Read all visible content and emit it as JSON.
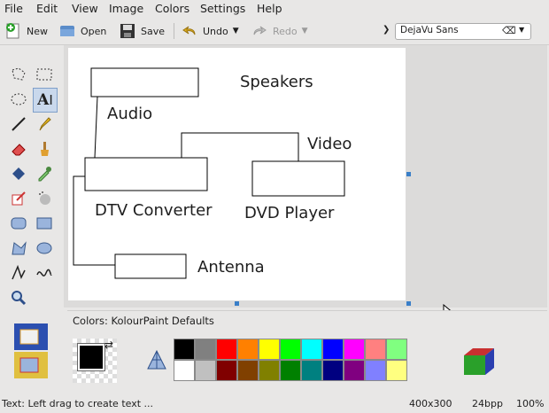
{
  "menu": [
    "File",
    "Edit",
    "View",
    "Image",
    "Colors",
    "Settings",
    "Help"
  ],
  "toolbar": {
    "new_label": "New",
    "open_label": "Open",
    "save_label": "Save",
    "undo_label": "Undo",
    "redo_label": "Redo",
    "font_value": "DejaVu Sans"
  },
  "diagram": {
    "speakers": "Speakers",
    "audio": "Audio",
    "video": "Video",
    "dtv": "DTV Converter",
    "dvd": "DVD Player",
    "antenna": "Antenna"
  },
  "colors_panel": {
    "title": "Colors: KolourPaint Defaults"
  },
  "palette_row1": [
    "#000000",
    "#808080",
    "#ff0000",
    "#ff8000",
    "#ffff00",
    "#00ff00",
    "#00ffff",
    "#0000ff",
    "#ff00ff",
    "#ff8080",
    "#80ff80"
  ],
  "palette_row2": [
    "#ffffff",
    "#c0c0c0",
    "#800000",
    "#804000",
    "#808000",
    "#008000",
    "#008080",
    "#000080",
    "#800080",
    "#8080ff",
    "#ffff80"
  ],
  "status": {
    "hint": "Text: Left drag to create text ...",
    "size": "400x300",
    "depth": "24bpp",
    "zoom": "100%"
  }
}
